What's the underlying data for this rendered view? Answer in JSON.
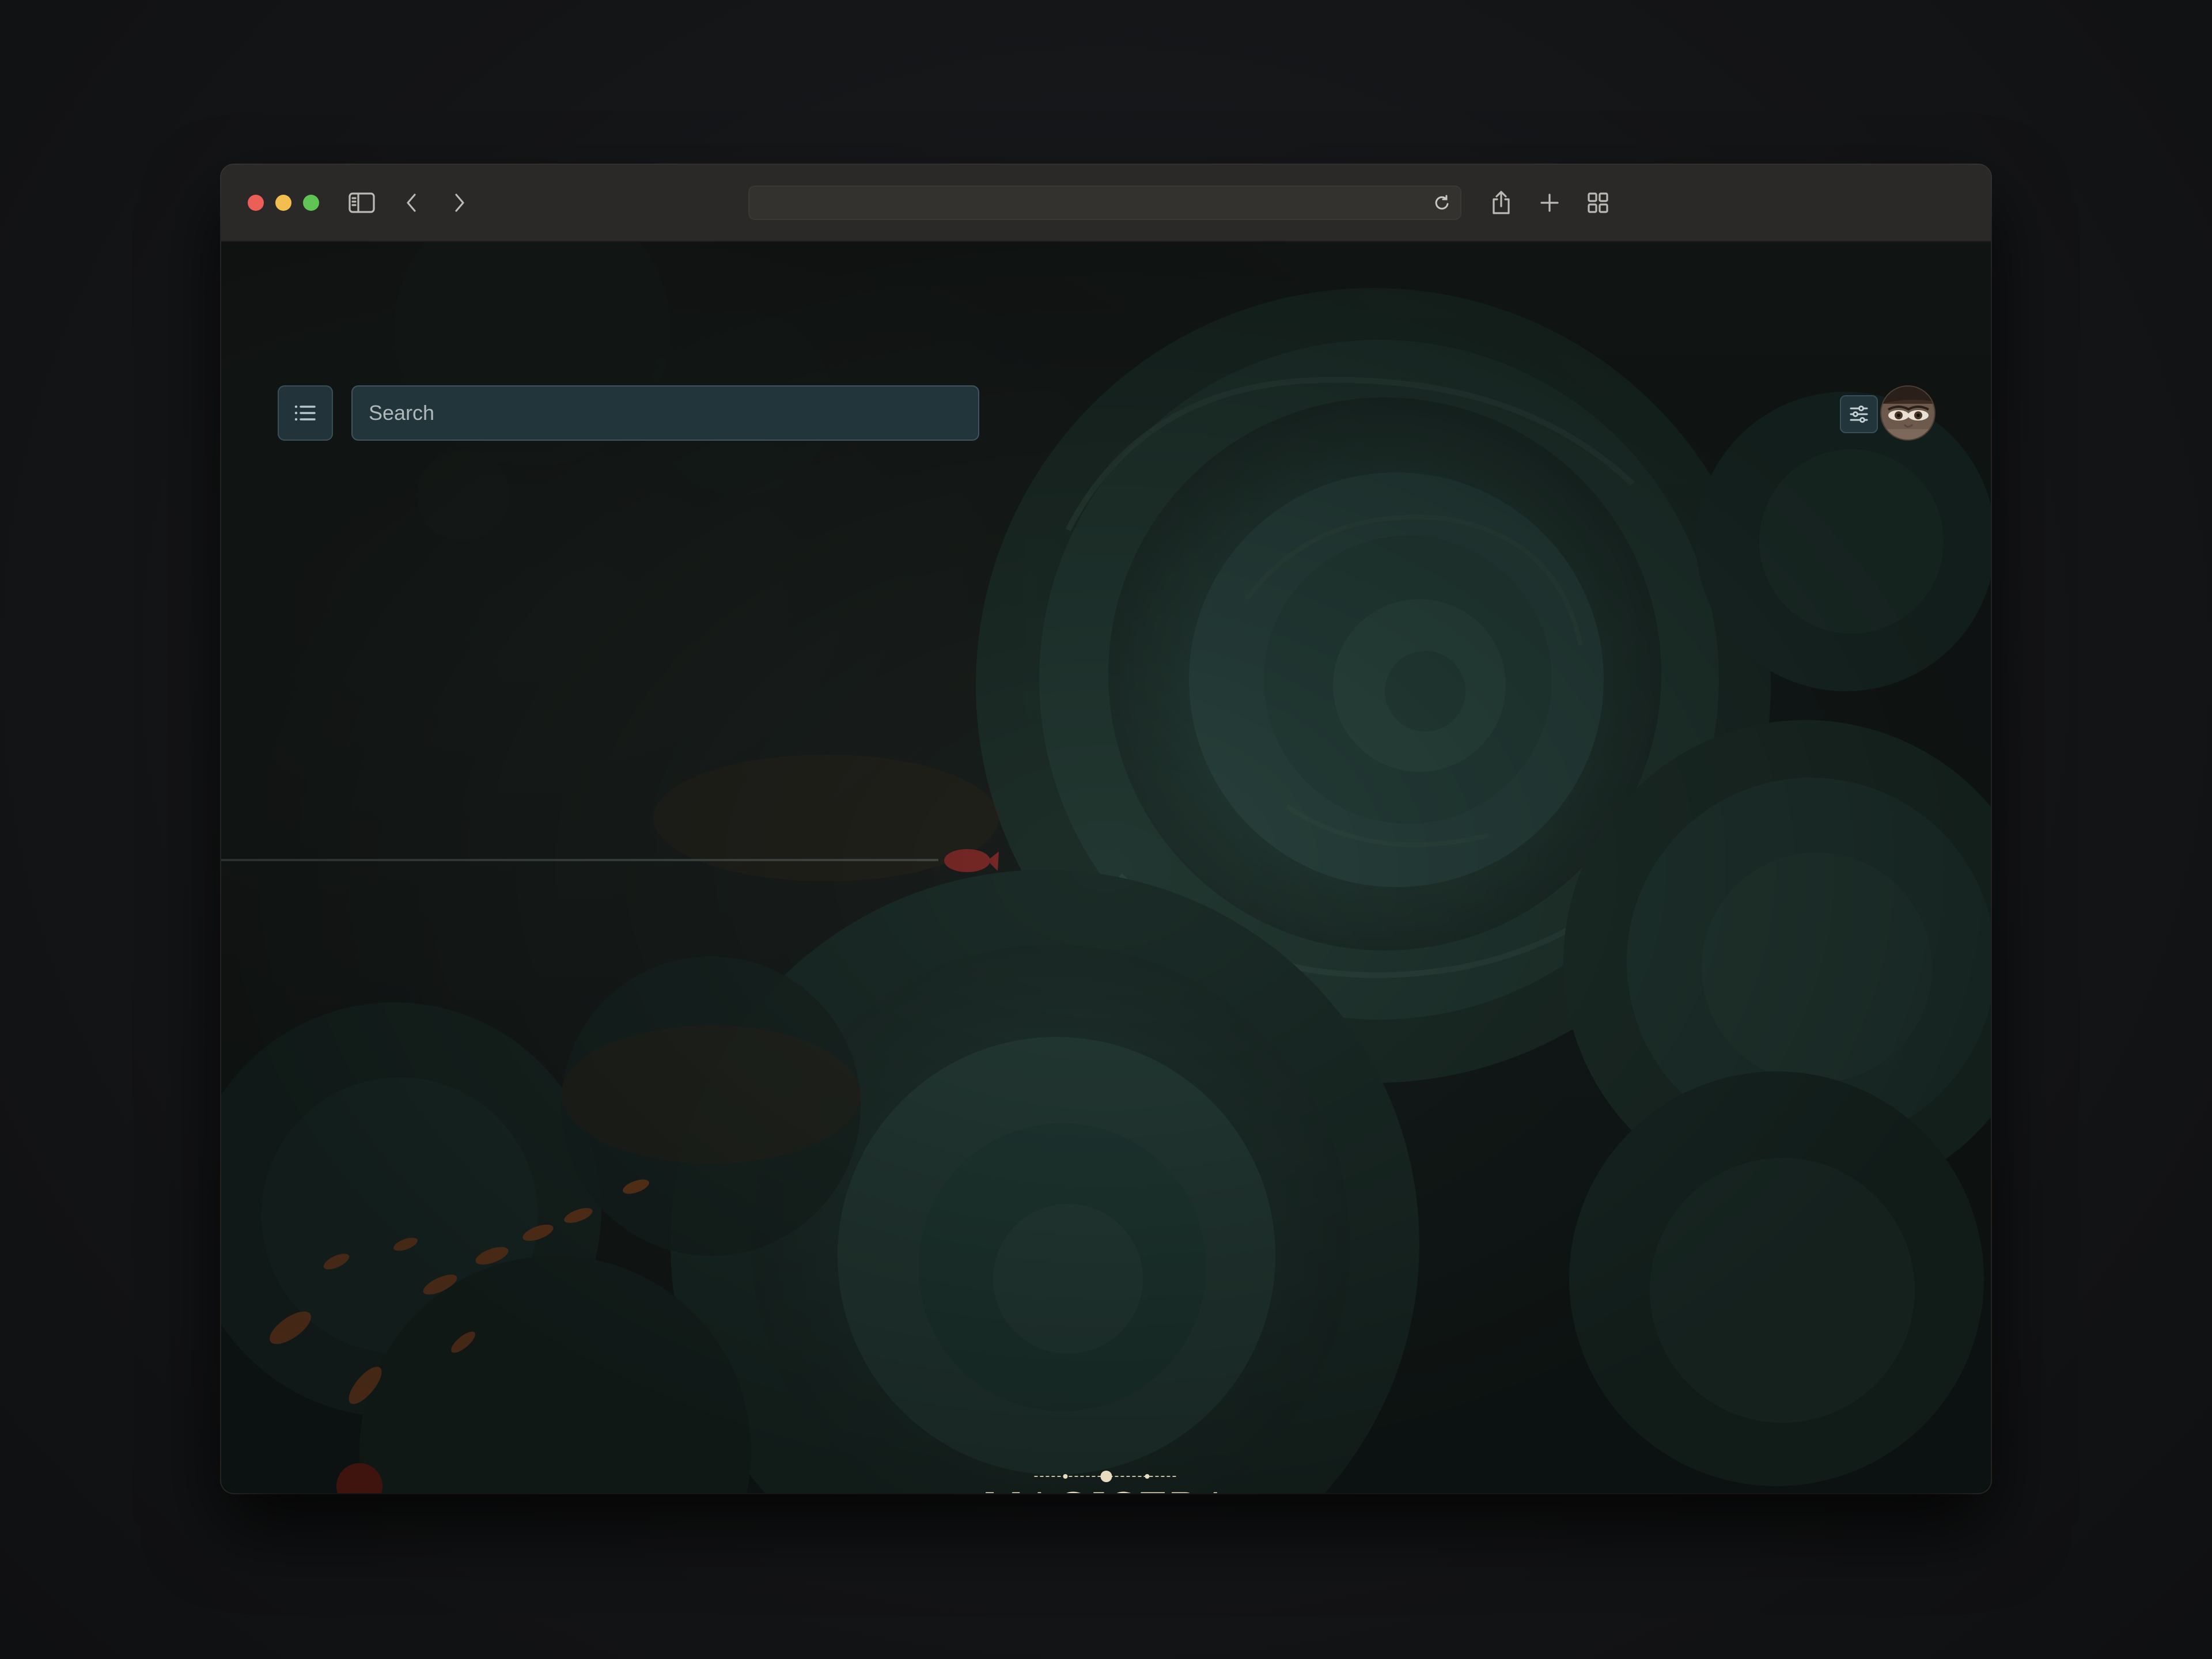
{
  "window": {
    "traffic_lights": [
      "close",
      "minimize",
      "maximize"
    ]
  },
  "toolbar": {
    "icons": [
      "sidebar-icon",
      "back-arrow-icon",
      "forward-arrow-icon",
      "reload-icon",
      "share-icon",
      "new-tab-icon",
      "tab-overview-icon"
    ],
    "address_value": ""
  },
  "page": {
    "search": {
      "placeholder": "Search",
      "value": ""
    },
    "menu_icon": "list-icon",
    "filter_icon": "sliders-icon",
    "brand": "MAGISTRA"
  },
  "colors": {
    "page_background": "#141517",
    "titlebar": "#2b2927",
    "control_fill": "#22353b",
    "control_border": "#3f565d",
    "brand_text": "#e9dcc0",
    "traffic_close": "#ec5f57",
    "traffic_minimize": "#f4bd4f",
    "traffic_maximize": "#5fc454"
  }
}
